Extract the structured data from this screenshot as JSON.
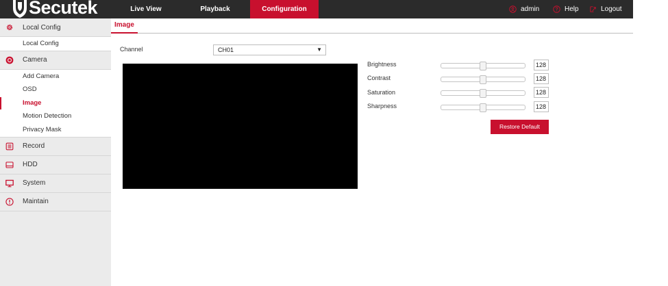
{
  "brand": {
    "name": "Secutek",
    "accent": "#c8102e",
    "topbar_bg": "#2b2b2b"
  },
  "nav": {
    "live_view": "Live View",
    "playback": "Playback",
    "configuration": "Configuration",
    "active": "Configuration"
  },
  "user": {
    "admin": "admin",
    "help": "Help",
    "logout": "Logout",
    "admin_icon": "user-circle-icon",
    "help_icon": "help-circle-icon",
    "logout_icon": "logout-icon"
  },
  "sidebar": {
    "groups": [
      {
        "label": "Local Config",
        "icon": "gear-icon",
        "subs": [
          "Local Config"
        ]
      },
      {
        "label": "Camera",
        "icon": "camera-icon",
        "subs": [
          "Add Camera",
          "OSD",
          "Image",
          "Motion Detection",
          "Privacy Mask"
        ]
      },
      {
        "label": "Record",
        "icon": "record-icon",
        "subs": []
      },
      {
        "label": "HDD",
        "icon": "hdd-icon",
        "subs": []
      },
      {
        "label": "System",
        "icon": "monitor-icon",
        "subs": []
      },
      {
        "label": "Maintain",
        "icon": "info-icon",
        "subs": []
      }
    ],
    "active_item": "Image"
  },
  "page": {
    "tab": "Image",
    "channel_label": "Channel",
    "channel_value": "CH01",
    "adjustments": [
      {
        "label": "Brightness",
        "value": "128",
        "fraction": 0.5
      },
      {
        "label": "Contrast",
        "value": "128",
        "fraction": 0.5
      },
      {
        "label": "Saturation",
        "value": "128",
        "fraction": 0.5
      },
      {
        "label": "Sharpness",
        "value": "128",
        "fraction": 0.5
      }
    ],
    "restore_label": "Restore Default"
  }
}
